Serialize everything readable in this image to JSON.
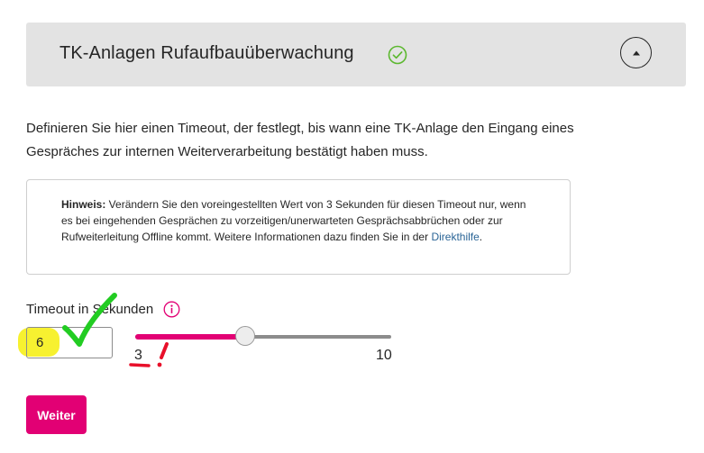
{
  "header": {
    "title": "TK-Anlagen Rufaufbauüberwachung",
    "status_icon": "check-circle-icon",
    "status_color": "#5cb82f",
    "collapse_icon": "caret-up-icon"
  },
  "description": "Definieren Sie hier einen Timeout, der festlegt, bis wann eine TK-Anlage den Eingang eines Gespräches zur internen Weiterverarbeitung bestätigt haben muss.",
  "note": {
    "label": "Hinweis:",
    "text": " Verändern Sie den voreingestellten Wert von 3 Sekunden für diesen Timeout nur, wenn es bei eingehenden Gesprächen zu vorzeitigen/unerwarteten Gesprächsabbrüchen oder zur Rufweiterleitung Offline kommt. Weitere Informationen dazu finden Sie in der ",
    "link": "Direkthilfe",
    "suffix": "."
  },
  "timeout": {
    "label": "Timeout in Sekunden",
    "info_icon": "info-icon",
    "value": "6",
    "slider": {
      "min": "3",
      "max": "10",
      "value": 6,
      "fill_color": "#e20074"
    }
  },
  "actions": {
    "next_label": "Weiter",
    "accent_color": "#e20074"
  },
  "annotations": {
    "highlight_color": "#f6f01a",
    "checkmark_color": "#22cc22",
    "mark_color": "#e8102a"
  }
}
